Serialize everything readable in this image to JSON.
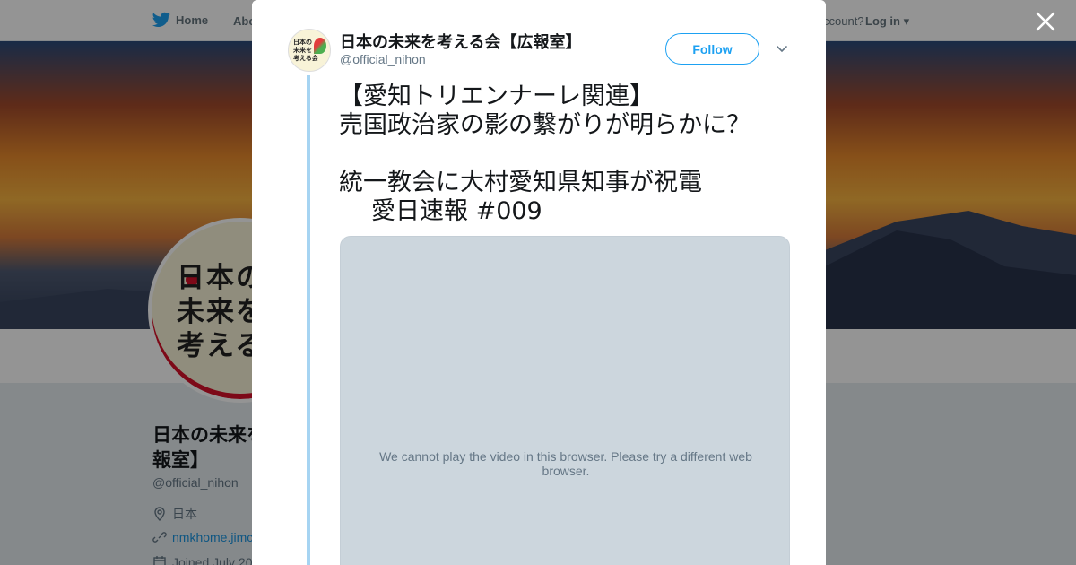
{
  "topnav": {
    "home_label": "Home",
    "about_label": "Abo",
    "account_text": "ccount?",
    "login_label": "Log in"
  },
  "profile": {
    "avatar_text": [
      "日本の",
      "未来を",
      "考える"
    ],
    "name": "日本の未来を考える会【広報室】",
    "name_visible": [
      "日本の未来を考",
      "報室】"
    ],
    "handle": "@official_nihon",
    "location": "日本",
    "url": "nmkhome.jimc",
    "joined": "Joined July 20"
  },
  "modal": {
    "author_name": "日本の未来を考える会【広報室】",
    "author_handle": "@official_nihon",
    "avatar_text": [
      "日本の",
      "未来を",
      "考える会"
    ],
    "follow_label": "Follow",
    "tweet_lines": [
      "【愛知トリエンナーレ関連】",
      "売国政治家の影の繋がりが明らかに？",
      "",
      "統一教会に大村愛知県知事が祝電",
      "愛日速報 #009"
    ],
    "video_message": "We cannot play the video in this browser. Please try a different web browser."
  },
  "colors": {
    "twitter_blue": "#1da1f2",
    "thread_line": "#a6d4f2",
    "video_bg": "#ccd6dd",
    "brand_red": "#d8102a"
  },
  "icons": {
    "home": "twitter-bird-icon",
    "close": "close-icon",
    "caret": "chevron-down-icon",
    "location": "location-pin-icon",
    "link": "link-icon",
    "calendar": "calendar-icon"
  }
}
